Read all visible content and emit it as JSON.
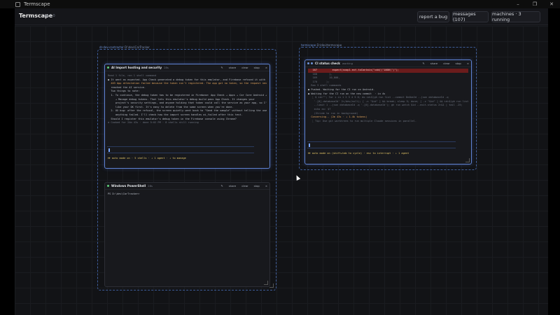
{
  "window": {
    "title": "Termscape",
    "controls": [
      "–",
      "❐",
      "✕"
    ]
  },
  "app": {
    "name": "Termscape",
    "version": "v0.2.0",
    "buttons": {
      "report": "report a bug",
      "messages": "messages (107)",
      "machines": "machines · 3 running"
    }
  },
  "groups": {
    "left": {
      "label_main": "dr-dev-contractor",
      "label_path": "D:\\dev\\CarTracker"
    },
    "right": {
      "label_main": "termscape",
      "label_path": "D:\\dev\\termscape"
    }
  },
  "panel_actions": [
    "✎",
    "share",
    "clear",
    "stop",
    "×"
  ],
  "panels": {
    "ai": {
      "title": "AI Import hosting and security",
      "status": "28s",
      "lines": [
        {
          "cls": "dim",
          "t": "Read 1 file, ran 1 shell command"
        },
        {
          "cls": "",
          "t": ""
        },
        {
          "cls": "",
          "t": "● It went as expected. App Check generated a debug token for this emulator, and Firebase refused it with"
        },
        {
          "cls": "warn",
          "t": "  403 App attestation failed because the token isn't registered. The app got no token, so the request never"
        },
        {
          "cls": "",
          "t": "  reached the AI service."
        },
        {
          "cls": "",
          "t": ""
        },
        {
          "cls": "",
          "t": "  Two things to note:"
        },
        {
          "cls": "",
          "t": "  1. To continue, the debug token has to be registered in Firebase: App Check → Apps → Car Care Android →"
        },
        {
          "cls": "",
          "t": "     → Manage debug tokens. That lets this emulator's debug build pass App Check. It changes your"
        },
        {
          "cls": "",
          "t": "     project's security settings, and anyone holding that token could call the service as your app, so I'd"
        },
        {
          "cls": "",
          "t": "     like your OK first. It's easy to delete from the same screen when you're done."
        },
        {
          "cls": "",
          "t": "  2. UX bug: after the refusal, the screen quietly went back to \"Send the sample\" without telling the user"
        },
        {
          "cls": "",
          "t": "     anything failed. I'll check how the import screen handles ai_failed after this test."
        },
        {
          "cls": "",
          "t": ""
        },
        {
          "cls": "",
          "t": "  Should I register this emulator's debug token in the Firebase console using Chrome?"
        },
        {
          "cls": "",
          "t": ""
        },
        {
          "cls": "dim",
          "t": "✻ Cooked for 24m 43s · done 5:02 PM · 8 shells still running"
        }
      ],
      "footer": "⏵⏵ auto mode on · 5 shells · ↓ 1 agent · ↓ to manage"
    },
    "ps": {
      "title": "Windows PowerShell",
      "status": "28s",
      "lines": [
        {
          "cls": "",
          "t": "PS D:\\dev\\CarTracker>"
        }
      ]
    },
    "ci": {
      "title": "CI status check",
      "status": "working",
      "lines": [
        {
          "cls": "err-bg",
          "t": "   167          expect(snap1.ext.toContain(\"cdd(\\\"1000\\\")\");     "
        },
        {
          "cls": "dim",
          "t": "   168        },"
        },
        {
          "cls": "dim",
          "t": "   169        10_000,"
        },
        {
          "cls": "dim",
          "t": "   170      );"
        },
        {
          "cls": "",
          "t": ""
        },
        {
          "cls": "dim",
          "t": "  Ran 3 shell commands"
        },
        {
          "cls": "",
          "t": ""
        },
        {
          "cls": "",
          "t": "● Pushed. Waiting for the CI run on Android."
        },
        {
          "cls": "",
          "t": ""
        },
        {
          "cls": "",
          "t": "● Waiting for the CI run on the new commit  · in 4s"
        },
        {
          "cls": "dim",
          "t": "  ⎿ $ id=\"\"; for i in 1 2 3 4 5 6; do id=$(gh run list --commit 8e4be2d --json databaseId -q"
        },
        {
          "cls": "dim",
          "t": "    '.[0].databaseId' 2>/dev/null); [ -n \"$id\" ] && break; sleep 5; done; [ -z \"$id\" ] && id=$(gh run list"
        },
        {
          "cls": "dim",
          "t": "    --limit 1 --json databaseId -q '.[0].databaseId'); gh run watch $id --exit-status 2>&1 | tail -25;"
        },
        {
          "cls": "dim",
          "t": "    echo ex: $?"
        },
        {
          "cls": "dim",
          "t": "    (Stride to run in background)"
        },
        {
          "cls": "",
          "t": ""
        },
        {
          "cls": "warn",
          "t": "  Conversing.. (2m 43s · ↓ 1.4k tokens)"
        },
        {
          "cls": "dim",
          "t": "  ⎿ Tip: Use git worktrees to run multiple Claude sessions in parallel."
        }
      ],
      "footer": "⏵⏵ auto mode on (shift+tab to cycle) · esc to interrupt · ↓ 1 agent"
    }
  },
  "colors": {
    "accent": "#79a5ff",
    "focus_border": "#5f82d1",
    "dot_green": "#5fcf7a",
    "dot_blue": "#6f93d8"
  }
}
